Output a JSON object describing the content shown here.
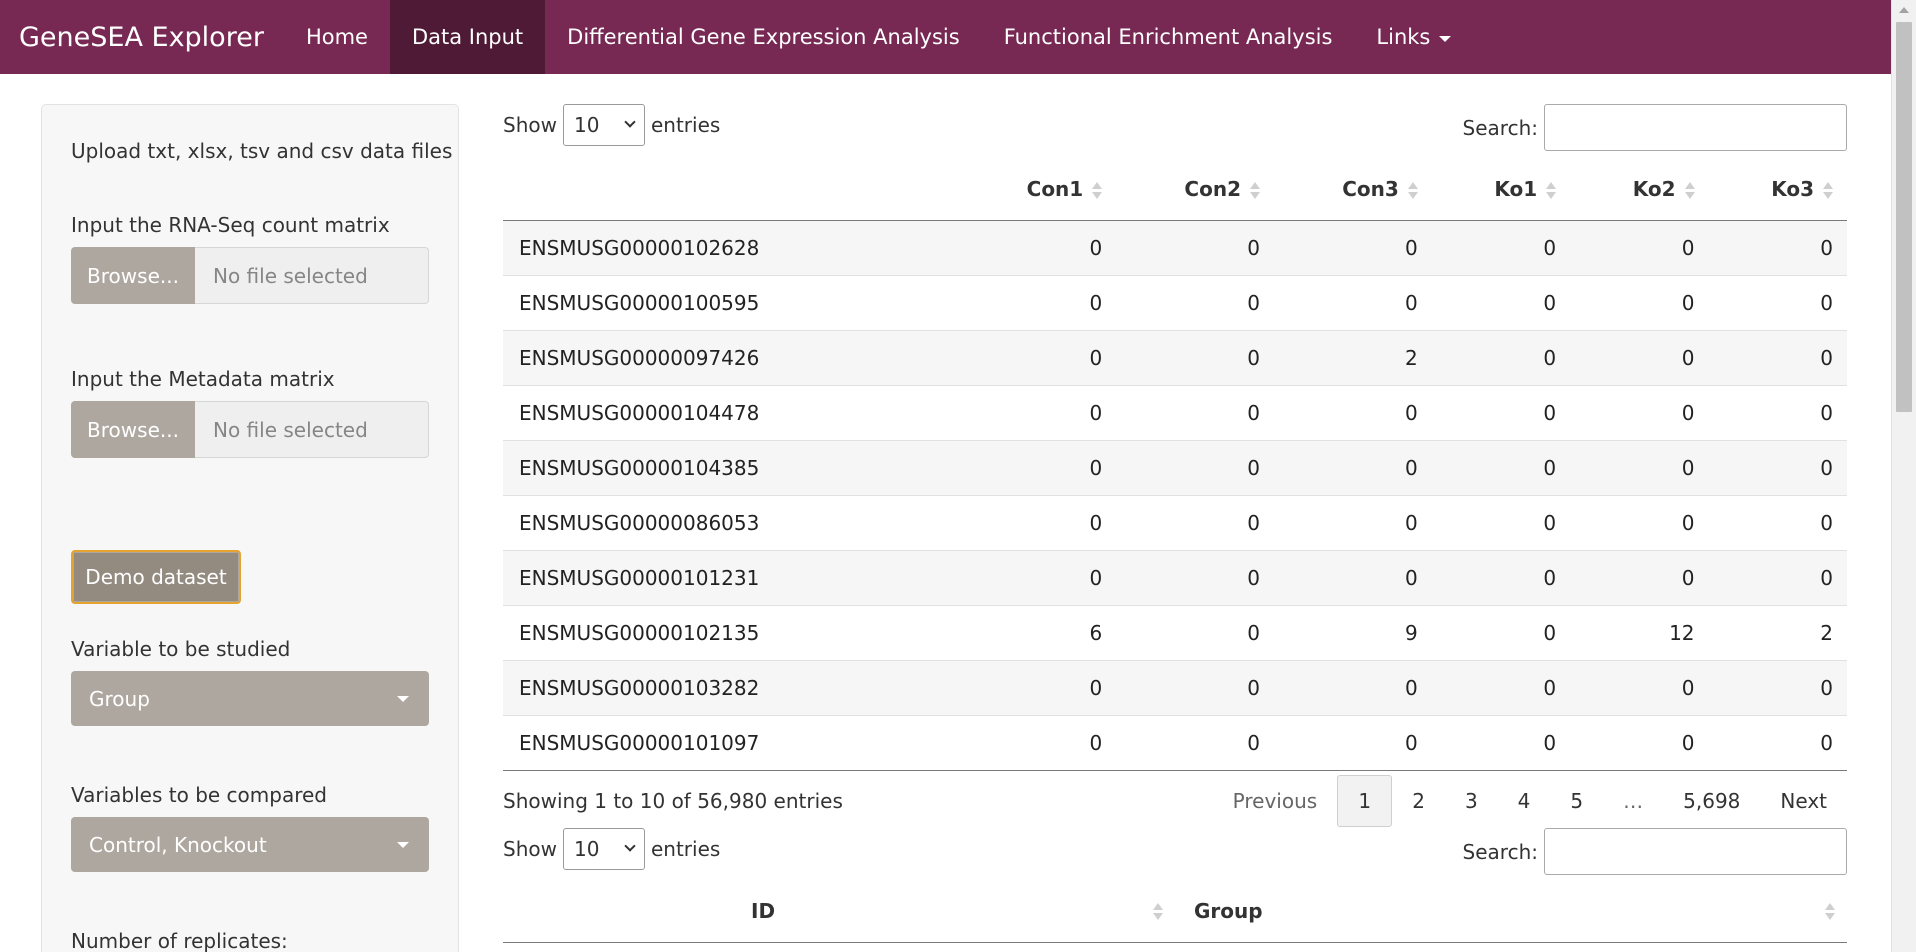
{
  "navbar": {
    "brand": "GeneSEA Explorer",
    "items": [
      {
        "label": "Home",
        "active": false
      },
      {
        "label": "Data Input",
        "active": true
      },
      {
        "label": "Differential Gene Expression Analysis",
        "active": false
      },
      {
        "label": "Functional Enrichment Analysis",
        "active": false
      },
      {
        "label": "Links",
        "active": false,
        "dropdown": true
      }
    ],
    "bg_color": "#772953",
    "active_color": "#4f1a36"
  },
  "sidebar": {
    "upload_note": "Upload txt, xlsx, tsv and csv data files",
    "count_label": "Input the RNA-Seq count matrix",
    "count_browse": "Browse...",
    "count_file": "No file selected",
    "meta_label": "Input the Metadata matrix",
    "meta_browse": "Browse...",
    "meta_file": "No file selected",
    "demo_button": "Demo dataset",
    "var_label": "Variable to be studied",
    "var_value": "Group",
    "compare_label": "Variables to be compared",
    "compare_value": "Control, Knockout",
    "replicates_label": "Number of replicates:"
  },
  "counts_table": {
    "show_label": "Show",
    "entries_label": "entries",
    "length_value": "10",
    "search_label": "Search:",
    "columns": [
      "",
      "Con1",
      "Con2",
      "Con3",
      "Ko1",
      "Ko2",
      "Ko3"
    ],
    "rows": [
      [
        "ENSMUSG00000102628",
        "0",
        "0",
        "0",
        "0",
        "0",
        "0"
      ],
      [
        "ENSMUSG00000100595",
        "0",
        "0",
        "0",
        "0",
        "0",
        "0"
      ],
      [
        "ENSMUSG00000097426",
        "0",
        "0",
        "2",
        "0",
        "0",
        "0"
      ],
      [
        "ENSMUSG00000104478",
        "0",
        "0",
        "0",
        "0",
        "0",
        "0"
      ],
      [
        "ENSMUSG00000104385",
        "0",
        "0",
        "0",
        "0",
        "0",
        "0"
      ],
      [
        "ENSMUSG00000086053",
        "0",
        "0",
        "0",
        "0",
        "0",
        "0"
      ],
      [
        "ENSMUSG00000101231",
        "0",
        "0",
        "0",
        "0",
        "0",
        "0"
      ],
      [
        "ENSMUSG00000102135",
        "6",
        "0",
        "9",
        "0",
        "12",
        "2"
      ],
      [
        "ENSMUSG00000103282",
        "0",
        "0",
        "0",
        "0",
        "0",
        "0"
      ],
      [
        "ENSMUSG00000101097",
        "0",
        "0",
        "0",
        "0",
        "0",
        "0"
      ]
    ],
    "info": "Showing 1 to 10 of 56,980 entries",
    "pagination": {
      "previous": "Previous",
      "pages": [
        "1",
        "2",
        "3",
        "4",
        "5",
        "…",
        "5,698"
      ],
      "current": "1",
      "next": "Next"
    }
  },
  "metadata_table": {
    "show_label": "Show",
    "entries_label": "entries",
    "length_value": "10",
    "search_label": "Search:",
    "columns": [
      "ID",
      "Group"
    ]
  }
}
